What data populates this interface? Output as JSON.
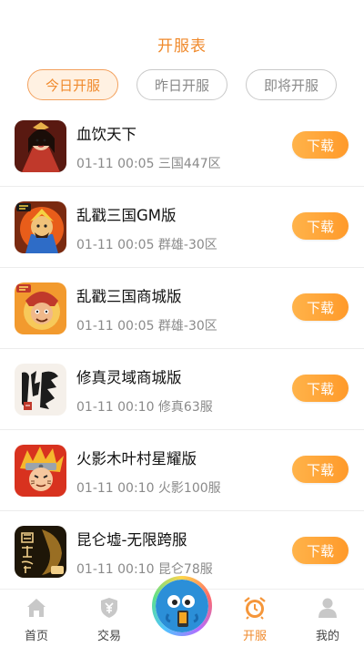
{
  "header": {
    "title": "开服表"
  },
  "tabs": [
    {
      "label": "今日开服",
      "active": true
    },
    {
      "label": "昨日开服",
      "active": false
    },
    {
      "label": "即将开服",
      "active": false
    }
  ],
  "games": [
    {
      "name": "血饮天下",
      "meta": "01-11 00:05 三国447区",
      "button": "下载",
      "icon": "xueyin-game-icon"
    },
    {
      "name": "乱戳三国GM版",
      "meta": "01-11 00:05 群雄-30区",
      "button": "下载",
      "icon": "luanchuo-gm-game-icon"
    },
    {
      "name": "乱戳三国商城版",
      "meta": "01-11 00:05 群雄-30区",
      "button": "下载",
      "icon": "luanchuo-shop-game-icon"
    },
    {
      "name": "修真灵域商城版",
      "meta": "01-11 00:10 修真63服",
      "button": "下载",
      "icon": "xiuzhen-game-icon"
    },
    {
      "name": "火影木叶村星耀版",
      "meta": "01-11 00:10 火影100服",
      "button": "下载",
      "icon": "huoying-game-icon"
    },
    {
      "name": "昆仑墟-无限跨服",
      "meta": "01-11 00:10 昆仑78服",
      "button": "下载",
      "icon": "kunlun-game-icon"
    }
  ],
  "nav": {
    "home": "首页",
    "trade": "交易",
    "server": "开服",
    "mine": "我的"
  },
  "colors": {
    "accent": "#f08a2c",
    "button": "#ff9f2e"
  }
}
